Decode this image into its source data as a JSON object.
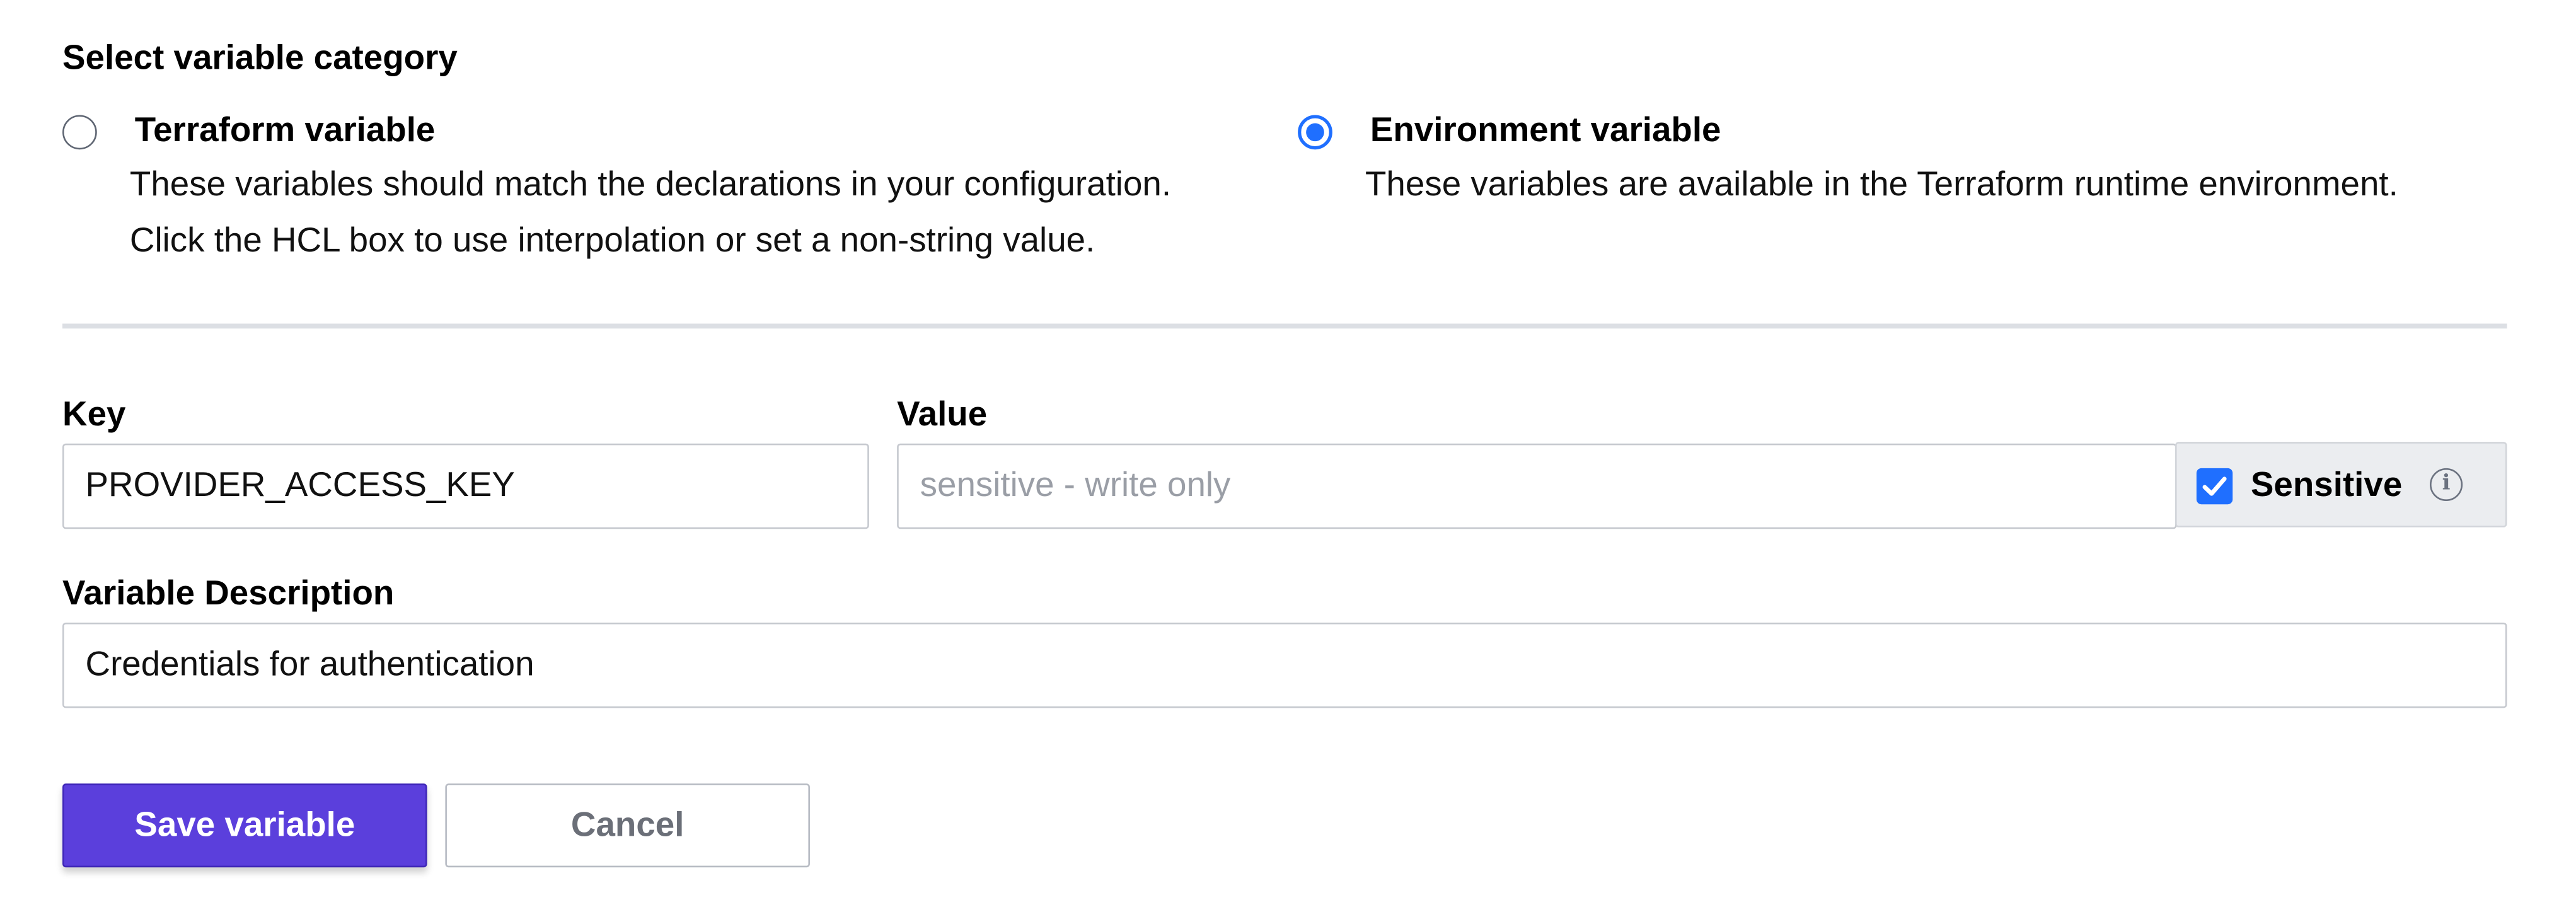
{
  "category": {
    "heading": "Select variable category",
    "options": [
      {
        "title": "Terraform variable",
        "description_lines": [
          "These variables should match the declarations in your configuration.",
          "Click the HCL box to use interpolation or set a non-string value."
        ],
        "selected": false
      },
      {
        "title": "Environment variable",
        "description_lines": [
          "These variables are available in the Terraform runtime environment."
        ],
        "selected": true
      }
    ]
  },
  "fields": {
    "key_label": "Key",
    "key_value": "PROVIDER_ACCESS_KEY",
    "value_label": "Value",
    "value_placeholder": "sensitive - write only",
    "sensitive_label": "Sensitive",
    "sensitive_checked": true,
    "info_glyph": "i",
    "description_label": "Variable Description",
    "description_value": "Credentials for authentication"
  },
  "actions": {
    "save_label": "Save variable",
    "cancel_label": "Cancel"
  },
  "colors": {
    "accent": "#1f6fff",
    "primary_button": "#5b3fdc"
  },
  "icons": {
    "info": "info-circle-icon",
    "check": "check-icon"
  }
}
